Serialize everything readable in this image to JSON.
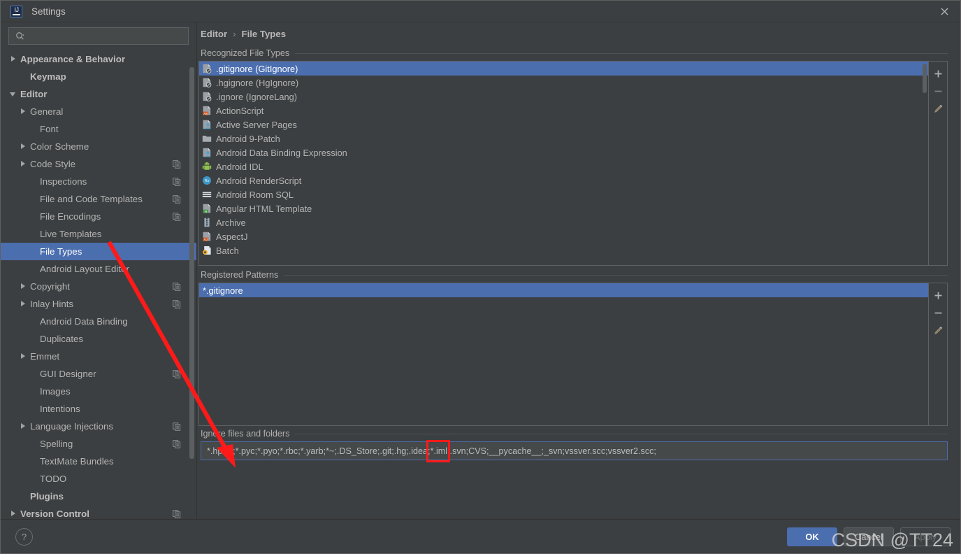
{
  "window": {
    "title": "Settings",
    "logo_icon": "intellij-idea-logo",
    "close_icon": "close-icon"
  },
  "search": {
    "icon": "search-icon",
    "value": "",
    "placeholder": ""
  },
  "breadcrumb": {
    "parent": "Editor",
    "separator": "›",
    "current": "File Types"
  },
  "sidebar": {
    "items": [
      {
        "label": "Appearance & Behavior",
        "indent": 0,
        "arrow": "closed",
        "bold": true,
        "copy": false
      },
      {
        "label": "Keymap",
        "indent": 1,
        "arrow": "none",
        "bold": true,
        "copy": false
      },
      {
        "label": "Editor",
        "indent": 0,
        "arrow": "open",
        "bold": true,
        "copy": false
      },
      {
        "label": "General",
        "indent": 1,
        "arrow": "closed",
        "bold": false,
        "copy": false
      },
      {
        "label": "Font",
        "indent": 2,
        "arrow": "none",
        "bold": false,
        "copy": false
      },
      {
        "label": "Color Scheme",
        "indent": 1,
        "arrow": "closed",
        "bold": false,
        "copy": false
      },
      {
        "label": "Code Style",
        "indent": 1,
        "arrow": "closed",
        "bold": false,
        "copy": true
      },
      {
        "label": "Inspections",
        "indent": 2,
        "arrow": "none",
        "bold": false,
        "copy": true
      },
      {
        "label": "File and Code Templates",
        "indent": 2,
        "arrow": "none",
        "bold": false,
        "copy": true
      },
      {
        "label": "File Encodings",
        "indent": 2,
        "arrow": "none",
        "bold": false,
        "copy": true
      },
      {
        "label": "Live Templates",
        "indent": 2,
        "arrow": "none",
        "bold": false,
        "copy": false
      },
      {
        "label": "File Types",
        "indent": 2,
        "arrow": "none",
        "bold": false,
        "copy": false,
        "selected": true
      },
      {
        "label": "Android Layout Editor",
        "indent": 2,
        "arrow": "none",
        "bold": false,
        "copy": false
      },
      {
        "label": "Copyright",
        "indent": 1,
        "arrow": "closed",
        "bold": false,
        "copy": true
      },
      {
        "label": "Inlay Hints",
        "indent": 1,
        "arrow": "closed",
        "bold": false,
        "copy": true
      },
      {
        "label": "Android Data Binding",
        "indent": 2,
        "arrow": "none",
        "bold": false,
        "copy": false
      },
      {
        "label": "Duplicates",
        "indent": 2,
        "arrow": "none",
        "bold": false,
        "copy": false
      },
      {
        "label": "Emmet",
        "indent": 1,
        "arrow": "closed",
        "bold": false,
        "copy": false
      },
      {
        "label": "GUI Designer",
        "indent": 2,
        "arrow": "none",
        "bold": false,
        "copy": true
      },
      {
        "label": "Images",
        "indent": 2,
        "arrow": "none",
        "bold": false,
        "copy": false
      },
      {
        "label": "Intentions",
        "indent": 2,
        "arrow": "none",
        "bold": false,
        "copy": false
      },
      {
        "label": "Language Injections",
        "indent": 1,
        "arrow": "closed",
        "bold": false,
        "copy": true
      },
      {
        "label": "Spelling",
        "indent": 2,
        "arrow": "none",
        "bold": false,
        "copy": true
      },
      {
        "label": "TextMate Bundles",
        "indent": 2,
        "arrow": "none",
        "bold": false,
        "copy": false
      },
      {
        "label": "TODO",
        "indent": 2,
        "arrow": "none",
        "bold": false,
        "copy": false
      },
      {
        "label": "Plugins",
        "indent": 1,
        "arrow": "none",
        "bold": true,
        "copy": false
      },
      {
        "label": "Version Control",
        "indent": 0,
        "arrow": "closed",
        "bold": true,
        "copy": true
      }
    ]
  },
  "recognized": {
    "title": "Recognized File Types",
    "items": [
      {
        "label": ".gitignore (GitIgnore)",
        "icon": "ignore-file-icon",
        "selected": true
      },
      {
        "label": ".hgignore (HgIgnore)",
        "icon": "ignore-file-icon"
      },
      {
        "label": ".ignore (IgnoreLang)",
        "icon": "ignore-file-icon"
      },
      {
        "label": "ActionScript",
        "icon": "actionscript-file-icon"
      },
      {
        "label": "Active Server Pages",
        "icon": "asp-file-icon"
      },
      {
        "label": "Android 9-Patch",
        "icon": "folder-icon"
      },
      {
        "label": "Android Data Binding Expression",
        "icon": "asp-file-icon"
      },
      {
        "label": "Android IDL",
        "icon": "android-icon"
      },
      {
        "label": "Android RenderScript",
        "icon": "renderscript-icon"
      },
      {
        "label": "Android Room SQL",
        "icon": "sql-icon"
      },
      {
        "label": "Angular HTML Template",
        "icon": "angular-html-icon"
      },
      {
        "label": "Archive",
        "icon": "archive-icon"
      },
      {
        "label": "AspectJ",
        "icon": "aspectj-file-icon"
      },
      {
        "label": "Batch",
        "icon": "batch-icon"
      }
    ],
    "toolbar": {
      "add": "add-icon",
      "remove": "remove-icon",
      "edit": "edit-pencil-icon"
    }
  },
  "patterns": {
    "title": "Registered Patterns",
    "items": [
      {
        "label": "*.gitignore",
        "selected": true
      }
    ],
    "toolbar": {
      "add": "add-icon",
      "remove": "remove-icon",
      "edit": "edit-pencil-icon"
    }
  },
  "ignore": {
    "title": "Ignore files and folders",
    "value": "*.hprof;*.pyc;*.pyo;*.rbc;*.yarb;*~;.DS_Store;.git;.hg;.idea;*.iml;.svn;CVS;__pycache__;_svn;vssver.scc;vssver2.scc;",
    "highlighted_token": "*.iml;"
  },
  "footer": {
    "help_label": "?",
    "ok_label": "OK",
    "cancel_label": "Cancel",
    "apply_label": "Apply"
  },
  "annotation": {
    "watermark": "CSDN @TT24",
    "arrow_color": "#ff1a1a",
    "highlight_color": "#ff1a1a"
  },
  "colors": {
    "accent": "#4b6eaf",
    "background": "#3c3f41",
    "field": "#45494a",
    "text": "#b4b4b4"
  }
}
